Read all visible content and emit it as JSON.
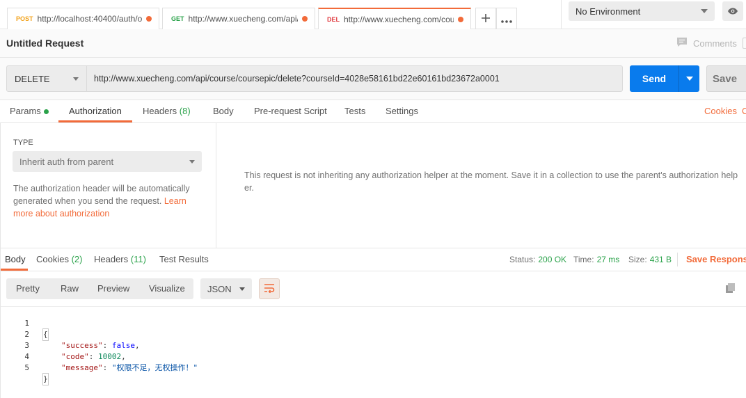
{
  "tabs": [
    {
      "method": "POST",
      "method_color": "#f2a21b",
      "url": "http://localhost:40400/auth/o…"
    },
    {
      "method": "GET",
      "method_color": "#2aa24a",
      "url": "http://www.xuecheng.com/api/…"
    },
    {
      "method": "DEL",
      "method_color": "#e0393e",
      "url": "http://www.xuecheng.com/cou…"
    }
  ],
  "environment": {
    "selected": "No Environment"
  },
  "request": {
    "title": "Untitled Request",
    "comments_label": "Comments",
    "method": "DELETE",
    "url": "http://www.xuecheng.com/api/course/coursepic/delete?courseId=4028e58161bd22e60161bd23672a0001",
    "send_label": "Send",
    "save_label": "Save"
  },
  "request_tabs": {
    "params": "Params",
    "authorization": "Authorization",
    "headers": "Headers",
    "headers_count": "(8)",
    "body": "Body",
    "prerequest": "Pre-request Script",
    "tests": "Tests",
    "settings": "Settings",
    "cookies": "Cookies",
    "code": "C"
  },
  "auth": {
    "type_label": "TYPE",
    "type_value": "Inherit auth from parent",
    "help_text": "The authorization header will be automatically generated when you send the request.",
    "help_link": "Learn more about authorization",
    "message": "This request is not inheriting any authorization helper at the moment. Save it in a collection to use the parent's authorization helper."
  },
  "response_tabs": {
    "body": "Body",
    "cookies": "Cookies",
    "cookies_count": "(2)",
    "headers": "Headers",
    "headers_count": "(11)",
    "test_results": "Test Results"
  },
  "response_status": {
    "status_label": "Status:",
    "status_value": "200 OK",
    "time_label": "Time:",
    "time_value": "27 ms",
    "size_label": "Size:",
    "size_value": "431 B",
    "save_response": "Save Response"
  },
  "response_view": {
    "pretty": "Pretty",
    "raw": "Raw",
    "preview": "Preview",
    "visualize": "Visualize",
    "format": "JSON"
  },
  "code_lines": [
    {
      "n": "1",
      "brace": "{"
    },
    {
      "n": "2",
      "key": "\"success\"",
      "value": "false",
      "comma": ","
    },
    {
      "n": "3",
      "key": "\"code\"",
      "value": "10002",
      "comma": ","
    },
    {
      "n": "4",
      "key": "\"message\"",
      "value": "\"权限不足，无权操作！\"",
      "comma": ""
    },
    {
      "n": "5",
      "brace": "}"
    }
  ],
  "colors": {
    "accent": "#f26b3a",
    "send": "#097bed",
    "success": "#2aa24a"
  }
}
